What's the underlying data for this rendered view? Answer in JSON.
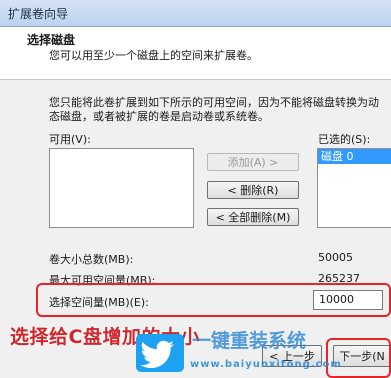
{
  "window": {
    "title": "扩展卷向导"
  },
  "header": {
    "title": "选择磁盘",
    "subtitle": "您可以用至少一个磁盘上的空间来扩展卷。"
  },
  "description": "您只能将此卷扩展到如下所示的可用空间，因为不能将磁盘转换为动态磁盘，或者被扩展的卷是启动卷或系统卷。",
  "available": {
    "label": "可用(V):",
    "items": []
  },
  "selected": {
    "label": "已选的(S):",
    "items": [
      "磁盘 0"
    ]
  },
  "buttons": {
    "add": "添加(A) >",
    "remove": "< 删除(R)",
    "remove_all": "< 全部删除(M)"
  },
  "fields": {
    "total_label": "卷大小总数(MB):",
    "total_value": "50005",
    "max_label": "最大可用空间量(MB):",
    "max_value": "265237",
    "select_label": "选择空间量(MB)(E):",
    "select_value": "10000"
  },
  "navigation": {
    "back": "< 上一步",
    "next": "下一步(N"
  },
  "annotation": {
    "caption": "选择给C盘增加的大小"
  },
  "watermark": {
    "brand": "一键重装系统",
    "url": "www.baiyunxitong.com"
  }
}
